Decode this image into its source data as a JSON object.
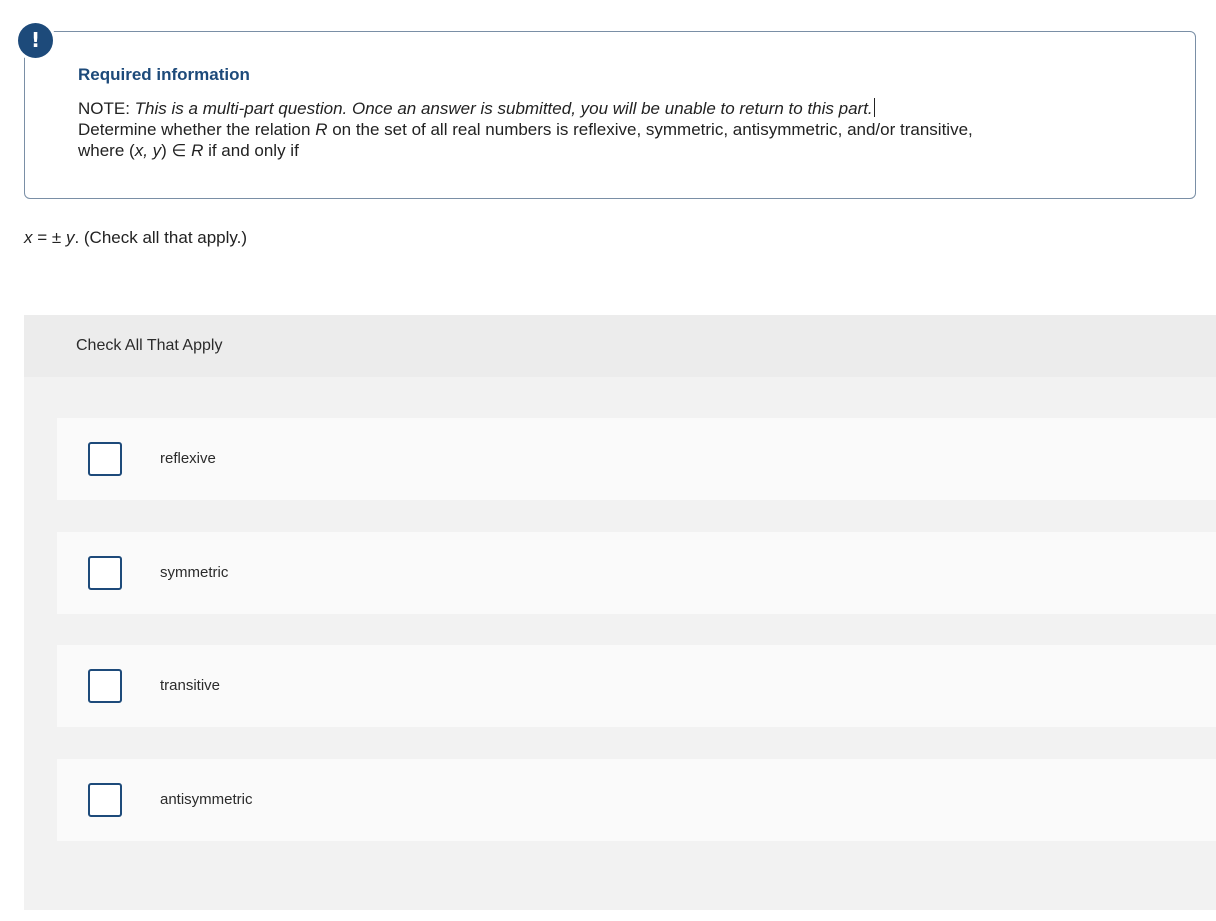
{
  "info": {
    "badge": "!",
    "title": "Required information",
    "note_prefix": "NOTE: ",
    "note_text": "This is a multi-part question. Once an answer is submitted, you will be unable to return to this part.",
    "line2_a": "Determine whether the relation ",
    "line2_R": "R",
    "line2_b": " on the set of all real numbers is reflexive, symmetric, antisymmetric, and/or transitive,",
    "line3_a": "where (",
    "line3_xy": "x, y",
    "line3_b": ") ∈ ",
    "line3_R": "R",
    "line3_c": " if and only if"
  },
  "question": {
    "x": "x",
    "mid": " = ± ",
    "y": "y",
    "rest": ". (Check all that apply.)"
  },
  "panel": {
    "header": "Check All That Apply",
    "options": [
      {
        "label": "reflexive",
        "checked": false
      },
      {
        "label": "symmetric",
        "checked": false
      },
      {
        "label": "transitive",
        "checked": false
      },
      {
        "label": "antisymmetric",
        "checked": false
      }
    ]
  },
  "colors": {
    "accent": "#1d4a7a",
    "panel_bg": "#f2f2f2",
    "option_bg": "#fafafa"
  }
}
